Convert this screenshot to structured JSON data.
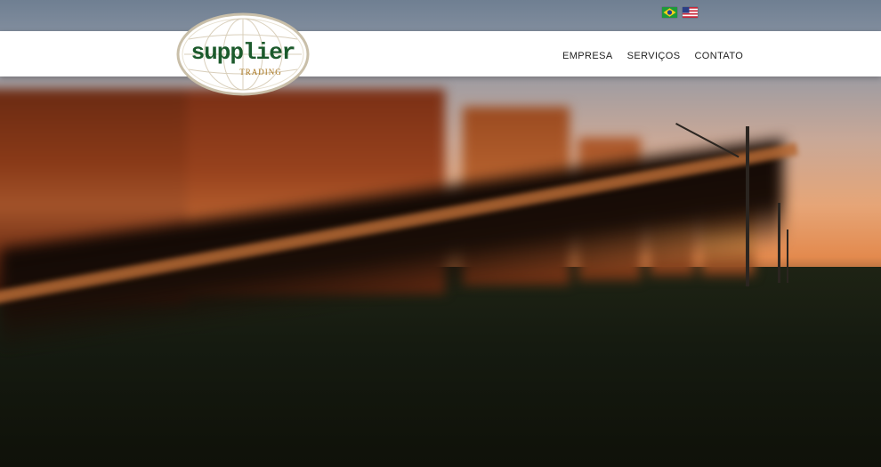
{
  "logo": {
    "name": "supplier",
    "subtitle": "TRADING"
  },
  "languages": [
    {
      "icon": "brazil-flag-icon"
    },
    {
      "icon": "usa-flag-icon"
    }
  ],
  "nav": {
    "items": [
      {
        "label": "EMPRESA"
      },
      {
        "label": "SERVIÇOS"
      },
      {
        "label": "CONTATO"
      }
    ]
  },
  "colors": {
    "header_bg": "#ffffff",
    "logo_green": "#1c5a2c",
    "logo_gold": "#a8741b",
    "nav_text": "#222222"
  }
}
